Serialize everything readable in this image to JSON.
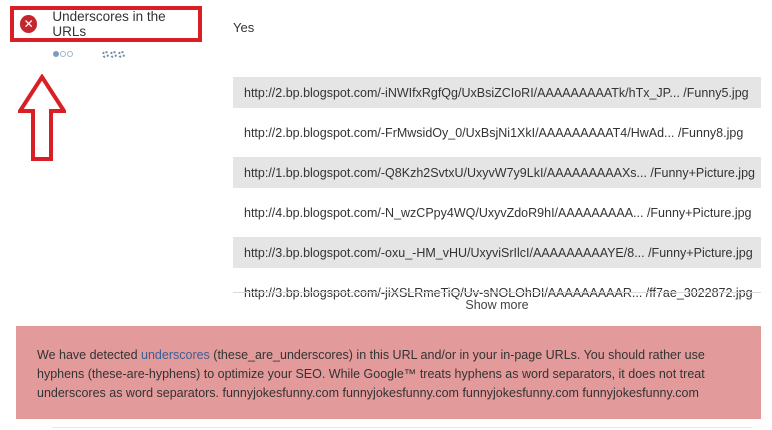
{
  "check": {
    "title": "Underscores in the URLs",
    "status_icon": "x-circle-icon",
    "status_color": "#c4262e",
    "highlight_color": "#d81f26",
    "importance_level": 1,
    "importance_max": 3,
    "difficulty_level": 3,
    "difficulty_max": 3,
    "value": "Yes"
  },
  "urls": [
    "http://2.bp.blogspot.com/-iNWIfxRgfQg/UxBsiZCIoRI/AAAAAAAAATk/hTx_JP... /Funny5.jpg",
    "http://2.bp.blogspot.com/-FrMwsidOy_0/UxBsjNi1XkI/AAAAAAAAAT4/HwAd... /Funny8.jpg",
    "http://1.bp.blogspot.com/-Q8Kzh2SvtxU/UxyvW7y9LkI/AAAAAAAAAXs... /Funny+Picture.jpg",
    "http://4.bp.blogspot.com/-N_wzCPpy4WQ/UxyvZdoR9hI/AAAAAAAAA... /Funny+Picture.jpg",
    "http://3.bp.blogspot.com/-oxu_-HM_vHU/UxyviSrIlcI/AAAAAAAAAYE/8... /Funny+Picture.jpg",
    "http://3.bp.blogspot.com/-jiXSLRmeTiQ/Uv-sNOLOhDI/AAAAAAAAAR... /ff7ae_3022872.jpg"
  ],
  "show_more_label": "Show more",
  "advice": {
    "text_before": "We have detected ",
    "link_text": "underscores",
    "text_after": " (these_are_underscores) in this URL and/or in your in-page URLs. You should rather use hyphens (these-are-hyphens) to optimize your SEO. While Google™ treats hyphens as word separators, it does not treat underscores as word separators. funnyjokesfunny.com funnyjokesfunny.com funnyjokesfunny.com funnyjokesfunny.com",
    "background_color": "#e39a9a"
  },
  "annotation": {
    "arrow_icon": "up-arrow-icon",
    "arrow_color": "#d81f26"
  }
}
